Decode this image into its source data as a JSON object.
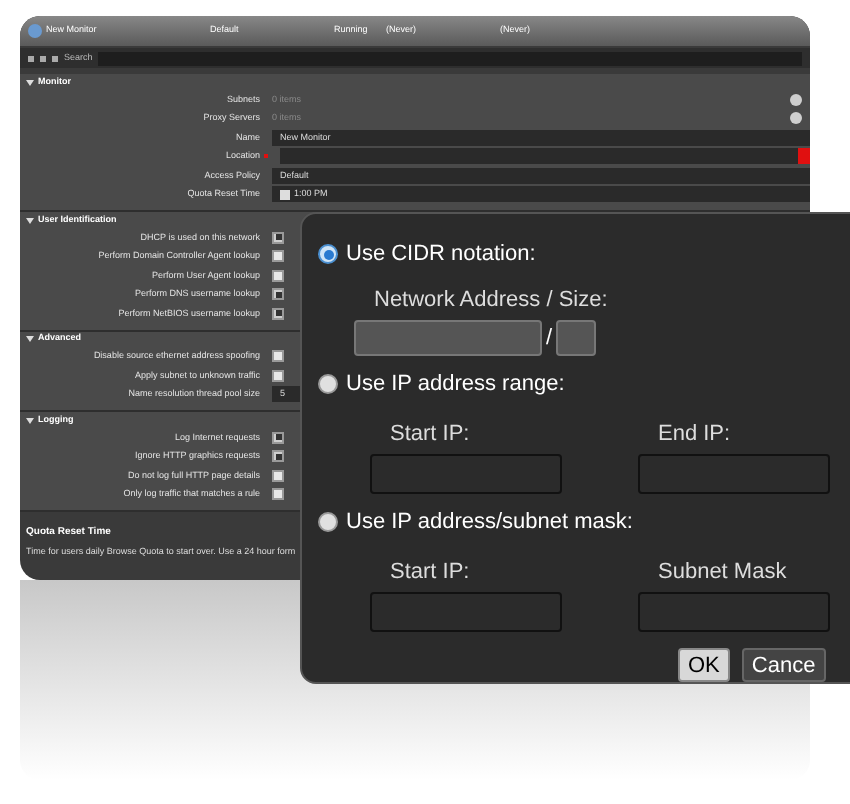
{
  "header": {
    "title": "New Monitor",
    "columns": [
      "Default",
      "Running",
      "(Never)",
      "(Never)"
    ]
  },
  "search": {
    "label": "Search"
  },
  "monitor": {
    "title": "Monitor",
    "expanded": true,
    "rows": [
      {
        "kind": "list",
        "label": "Subnets",
        "value": "0 items"
      },
      {
        "kind": "list",
        "label": "Proxy Servers",
        "value": "0 items"
      },
      {
        "kind": "text",
        "label": "Name",
        "value": "New Monitor"
      },
      {
        "kind": "required",
        "label": "Location",
        "value": ""
      },
      {
        "kind": "dropdown",
        "label": "Access Policy",
        "value": "Default"
      },
      {
        "kind": "time",
        "label": "Quota Reset Time",
        "value": "1:00 PM"
      }
    ]
  },
  "sections": [
    {
      "title": "User Identification",
      "expanded": true,
      "rows": [
        {
          "kind": "check",
          "label": "DHCP is used on this network",
          "checked": true
        },
        {
          "kind": "check",
          "label": "Perform Domain Controller Agent lookup",
          "checked": false
        },
        {
          "kind": "check",
          "label": "Perform User Agent lookup",
          "checked": false
        },
        {
          "kind": "check",
          "label": "Perform DNS username lookup",
          "checked": true
        },
        {
          "kind": "check",
          "label": "Perform NetBIOS username lookup",
          "checked": true
        }
      ]
    },
    {
      "title": "Advanced",
      "expanded": true,
      "rows": [
        {
          "kind": "check",
          "label": "Disable source ethernet address spoofing",
          "checked": false
        },
        {
          "kind": "check",
          "label": "Apply subnet to unknown traffic",
          "checked": false
        },
        {
          "kind": "number",
          "label": "Name resolution thread pool size",
          "value": "5"
        }
      ]
    },
    {
      "title": "Logging",
      "expanded": true,
      "rows": [
        {
          "kind": "check",
          "label": "Log Internet requests",
          "checked": true
        },
        {
          "kind": "check",
          "label": "Ignore HTTP graphics requests",
          "checked": true
        },
        {
          "kind": "check",
          "label": "Do not log full HTTP page details",
          "checked": false
        },
        {
          "kind": "check",
          "label": "Only log traffic that matches a rule",
          "checked": false
        }
      ]
    }
  ],
  "help": {
    "title": "Quota Reset Time",
    "text": "Time for users daily Browse Quota to start over.  Use a 24 hour form"
  },
  "dialog": {
    "options": [
      {
        "label": "Use CIDR notation:",
        "selected": true,
        "kind": "cidr",
        "fields": [
          "Network Address / Size:"
        ],
        "separator": "/"
      },
      {
        "label": "Use IP address range:",
        "selected": false,
        "kind": "pair",
        "fields": [
          "Start IP:",
          "End IP:"
        ]
      },
      {
        "label": "Use IP address/subnet mask:",
        "selected": false,
        "kind": "pair",
        "fields": [
          "Start IP:",
          "Subnet Mask"
        ]
      }
    ],
    "buttons": [
      "OK",
      "Cance"
    ]
  }
}
